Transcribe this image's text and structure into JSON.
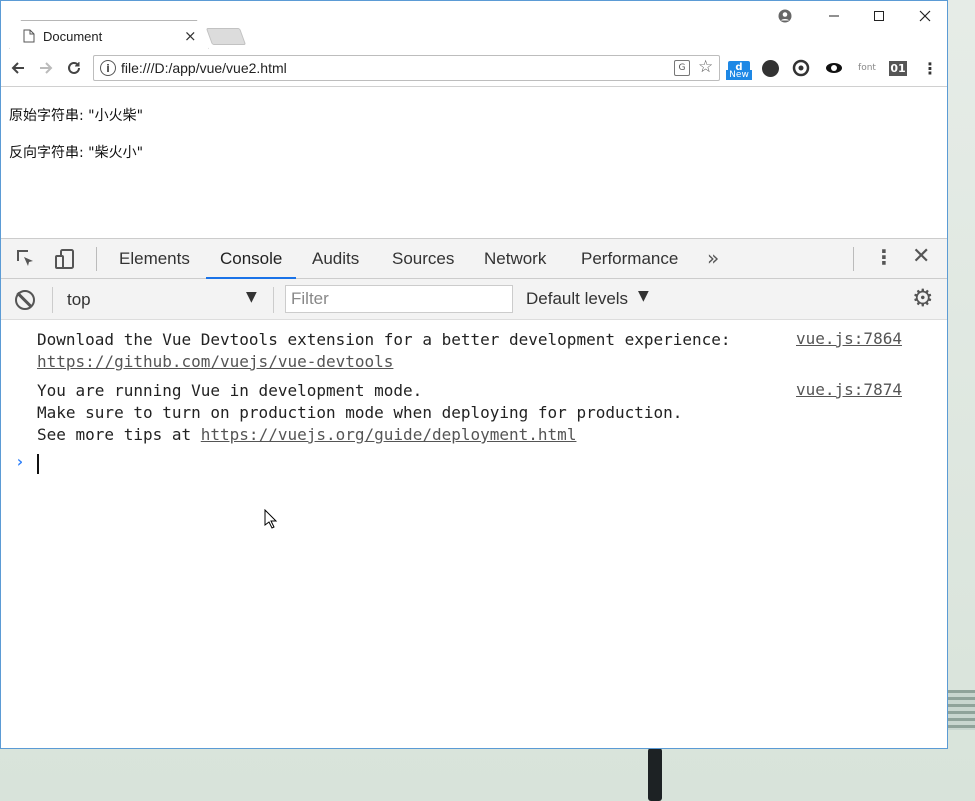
{
  "browser": {
    "tab_title": "Document",
    "tab_close": "×",
    "url": "file:///D:/app/vue/vue2.html",
    "extensions": {
      "new_label": "New",
      "font_label": "font",
      "binary_label": "01"
    }
  },
  "page": {
    "original_line": "原始字符串: \"小火柴\"",
    "reversed_line": "反向字符串: \"柴火小\""
  },
  "devtools": {
    "tabs": [
      "Elements",
      "Console",
      "Audits",
      "Sources",
      "Network",
      "Performance"
    ],
    "active_tab": "Console",
    "context": "top",
    "filter_placeholder": "Filter",
    "levels": "Default levels",
    "messages": [
      {
        "text": "Download the Vue Devtools extension for a better development experience:",
        "link": "https://github.com/vuejs/vue-devtools",
        "source": "vue.js:7864"
      },
      {
        "line1": "You are running Vue in development mode.",
        "line2": "Make sure to turn on production mode when deploying for production.",
        "line3_prefix": "See more tips at ",
        "link": "https://vuejs.org/guide/deployment.html",
        "source": "vue.js:7874"
      }
    ]
  }
}
